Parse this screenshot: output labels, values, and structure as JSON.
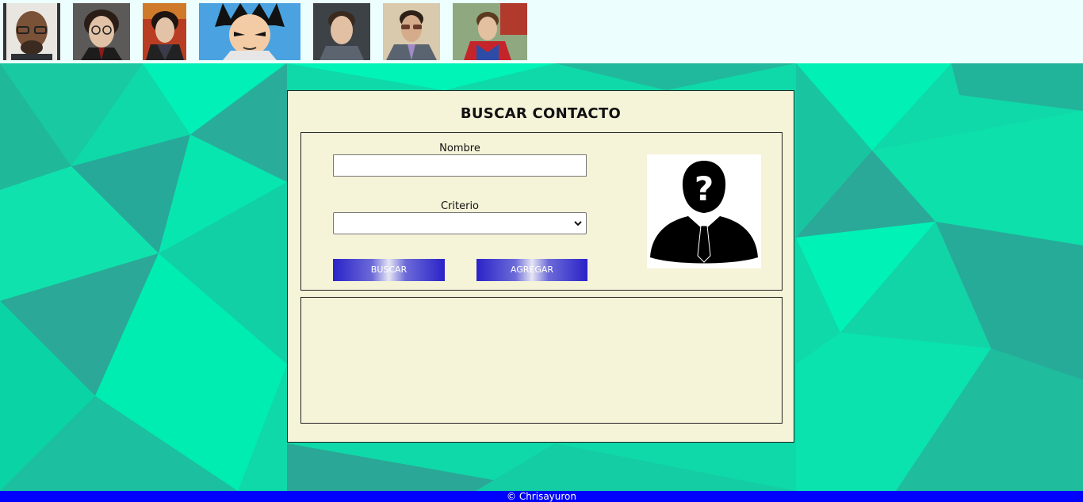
{
  "header": {
    "contacts": [
      {
        "name": "contact-thumb-1",
        "icon": "person-glasses-photo"
      },
      {
        "name": "contact-thumb-2",
        "icon": "person-glasses-photo"
      },
      {
        "name": "contact-thumb-3",
        "icon": "person-photo"
      },
      {
        "name": "contact-thumb-4",
        "icon": "anime-character-photo"
      },
      {
        "name": "contact-thumb-5",
        "icon": "person-photo"
      },
      {
        "name": "contact-thumb-6",
        "icon": "person-sunglasses-photo"
      },
      {
        "name": "contact-thumb-7",
        "icon": "superhero-photo"
      }
    ]
  },
  "form": {
    "title": "BUSCAR CONTACTO",
    "nombre_label": "Nombre",
    "nombre_value": "",
    "criterio_label": "Criterio",
    "criterio_value": "",
    "buscar_label": "BUSCAR",
    "agregar_label": "AGREGAR",
    "avatar_icon": "unknown-person-icon"
  },
  "footer": {
    "text": "© Chrisayuron"
  },
  "colors": {
    "topbar": "#ecfffe",
    "background": "#00e8b0",
    "card": "#f5f3d8",
    "button": "#2a23c8",
    "footer": "#0000ff"
  }
}
